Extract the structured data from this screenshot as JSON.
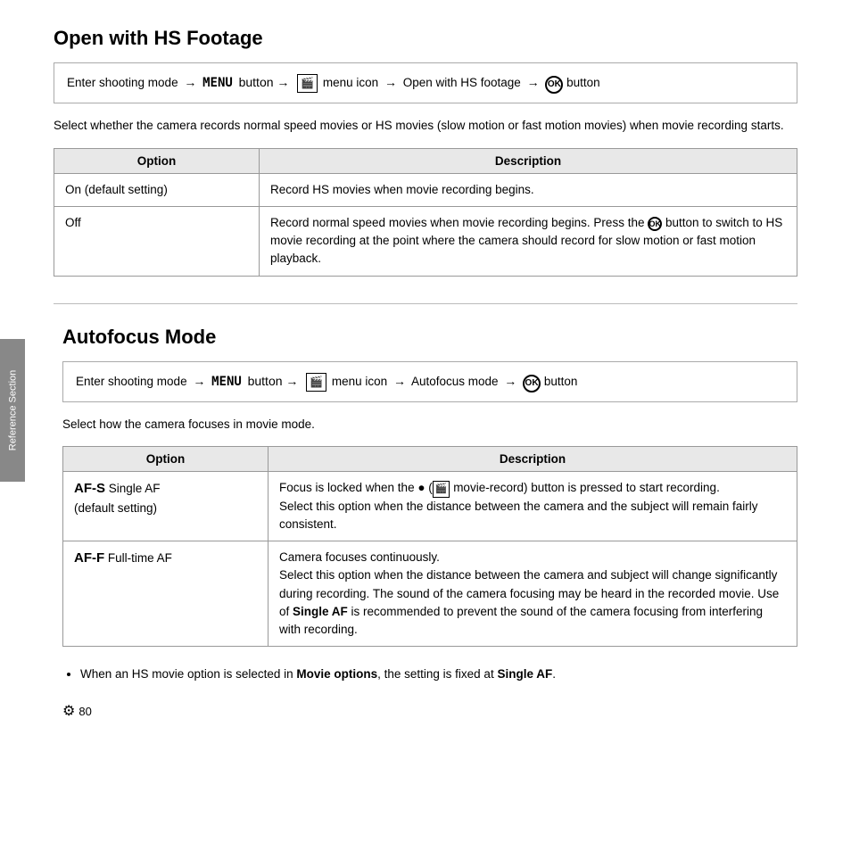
{
  "section1": {
    "title": "Open with HS Footage",
    "instruction": {
      "prefix": "Enter shooting mode",
      "arrow1": "→",
      "menu_label": "MENU",
      "arrow2": "→",
      "menu_icon_label": "🎬",
      "menu_icon_text": "menu icon",
      "arrow3": "→",
      "path_text": "Open with HS footage",
      "arrow4": "→",
      "ok_label": "OK",
      "suffix": "button"
    },
    "intro": "Select whether the camera records normal speed movies or HS movies (slow motion or fast motion movies) when movie recording starts.",
    "table": {
      "headers": [
        "Option",
        "Description"
      ],
      "rows": [
        {
          "option": "On (default setting)",
          "description": "Record HS movies when movie recording begins."
        },
        {
          "option": "Off",
          "description": "Record normal speed movies when movie recording begins. Press the OK button to switch to HS movie recording at the point where the camera should record for slow motion or fast motion playback."
        }
      ]
    }
  },
  "section2": {
    "title": "Autofocus Mode",
    "instruction": {
      "prefix": "Enter shooting mode",
      "arrow1": "→",
      "menu_label": "MENU",
      "arrow2": "→",
      "menu_icon_text": "menu icon",
      "arrow3": "→",
      "path_text": "Autofocus mode",
      "arrow4": "→",
      "ok_label": "OK",
      "suffix": "button"
    },
    "intro": "Select how the camera focuses in movie mode.",
    "table": {
      "headers": [
        "Option",
        "Description"
      ],
      "rows": [
        {
          "option_label": "AF-S",
          "option_suffix": "Single AF",
          "option_sub": "(default setting)",
          "description": "Focus is locked when the ● (movie-record) button is pressed to start recording.\nSelect this option when the distance between the camera and the subject will remain fairly consistent."
        },
        {
          "option_label": "AF-F",
          "option_suffix": "Full-time AF",
          "description": "Camera focuses continuously.\nSelect this option when the distance between the camera and subject will change significantly during recording. The sound of the camera focusing may be heard in the recorded movie. Use of Single AF is recommended to prevent the sound of the camera focusing from interfering with recording."
        }
      ]
    },
    "bullet": "When an HS movie option is selected in Movie options, the setting is fixed at Single AF.",
    "sidebar_text": "Reference Section",
    "page_number": "80"
  }
}
